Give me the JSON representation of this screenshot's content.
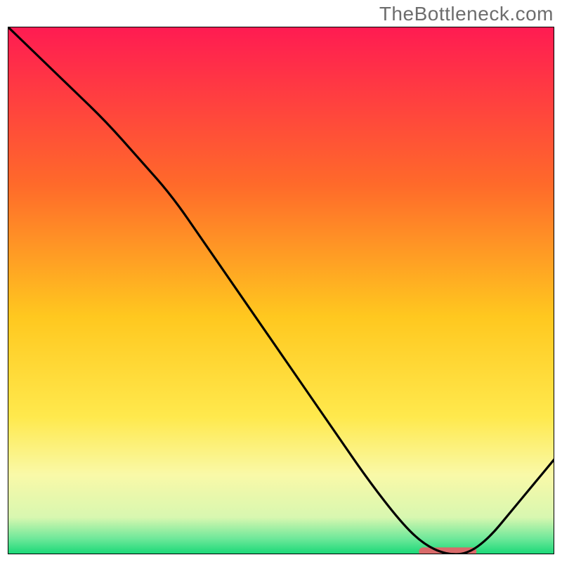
{
  "watermark": "TheBottleneck.com",
  "chart_data": {
    "type": "line",
    "title": "",
    "xlabel": "",
    "ylabel": "",
    "xlim": [
      0,
      100
    ],
    "ylim": [
      0,
      100
    ],
    "gradient_stops": [
      {
        "offset": 0,
        "color": "#ff1b52"
      },
      {
        "offset": 0.3,
        "color": "#ff6a2a"
      },
      {
        "offset": 0.55,
        "color": "#ffc81f"
      },
      {
        "offset": 0.74,
        "color": "#ffe94d"
      },
      {
        "offset": 0.85,
        "color": "#f9f9a8"
      },
      {
        "offset": 0.93,
        "color": "#d8f7b0"
      },
      {
        "offset": 0.97,
        "color": "#6fe89a"
      },
      {
        "offset": 1.0,
        "color": "#18d877"
      }
    ],
    "curve": {
      "x": [
        0,
        6,
        12,
        18,
        24,
        30,
        36,
        42,
        48,
        54,
        60,
        66,
        72,
        76,
        80,
        84,
        88,
        92,
        96,
        100
      ],
      "y": [
        100,
        94,
        88,
        82,
        75,
        68,
        59,
        50,
        41,
        32,
        23,
        14,
        6,
        2,
        0,
        0,
        3,
        8,
        13,
        18
      ]
    },
    "marker_segment": {
      "x0": 76,
      "x1": 85,
      "y": 0.5,
      "color": "#d96a6a",
      "width": 12
    },
    "border_color": "#000000",
    "border_width": 1
  }
}
